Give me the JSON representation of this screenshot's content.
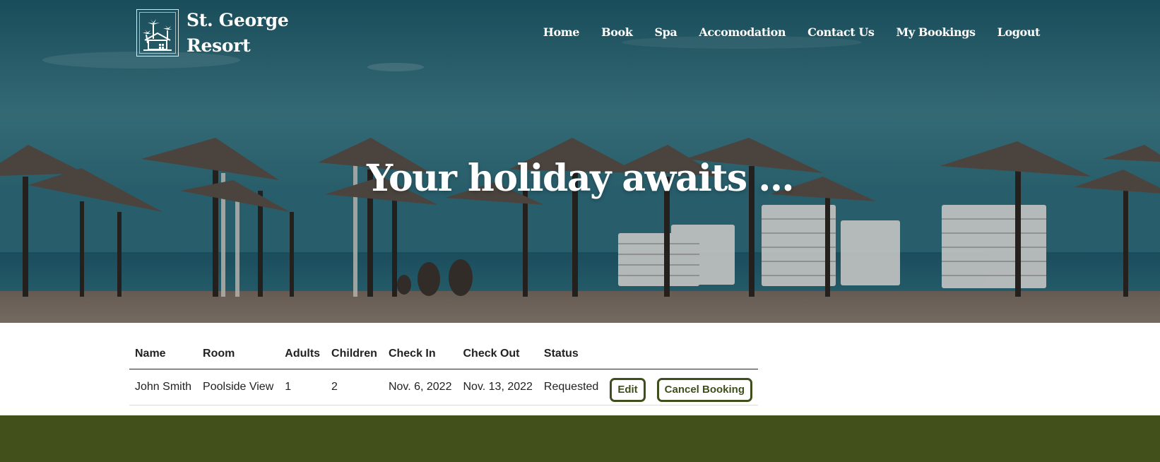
{
  "brand": {
    "name_line1": "St. George",
    "name_line2": "Resort",
    "logo_icon": "palm-house-icon"
  },
  "nav": {
    "items": [
      {
        "label": "Home"
      },
      {
        "label": "Book"
      },
      {
        "label": "Spa"
      },
      {
        "label": "Accomodation"
      },
      {
        "label": "Contact Us"
      },
      {
        "label": "My Bookings"
      },
      {
        "label": "Logout"
      }
    ]
  },
  "hero": {
    "title": "Your holiday awaits ..."
  },
  "bookings": {
    "headers": [
      "Name",
      "Room",
      "Adults",
      "Children",
      "Check In",
      "Check Out",
      "Status"
    ],
    "rows": [
      {
        "name": "John Smith",
        "room": "Poolside View",
        "adults": "1",
        "children": "2",
        "check_in": "Nov. 6, 2022",
        "check_out": "Nov. 13, 2022",
        "status": "Requested",
        "edit_label": "Edit",
        "cancel_label": "Cancel Booking"
      }
    ]
  },
  "colors": {
    "accent": "#42501c",
    "button_border": "#3f4f1c"
  }
}
